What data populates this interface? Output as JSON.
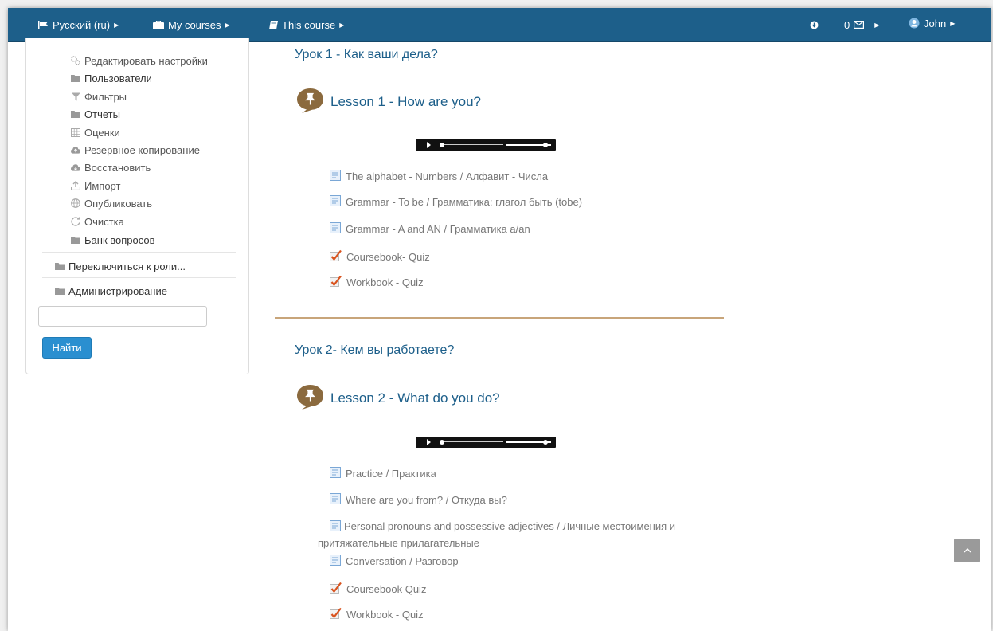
{
  "navbar": {
    "language": "Русский (ru)",
    "my_courses": "My courses",
    "this_course": "This course",
    "messages_count": "0",
    "user": "John"
  },
  "sidebar": {
    "items": [
      {
        "label": "Редактировать настройки",
        "icon": "gears-icon"
      },
      {
        "label": "Пользователи",
        "icon": "folder-icon"
      },
      {
        "label": "Фильтры",
        "icon": "filter-icon"
      },
      {
        "label": "Отчеты",
        "icon": "folder-icon"
      },
      {
        "label": "Оценки",
        "icon": "table-icon"
      },
      {
        "label": "Резервное копирование",
        "icon": "cloud-upload-icon"
      },
      {
        "label": "Восстановить",
        "icon": "cloud-download-icon"
      },
      {
        "label": "Импорт",
        "icon": "upload-icon"
      },
      {
        "label": "Опубликовать",
        "icon": "globe-icon"
      },
      {
        "label": "Очистка",
        "icon": "refresh-icon"
      },
      {
        "label": "Банк вопросов",
        "icon": "folder-icon"
      }
    ],
    "switch_role": "Переключиться к роли...",
    "administration": "Администрирование",
    "search_value": "",
    "search_button": "Найти"
  },
  "sections": [
    {
      "title": "Урок 1 - Как ваши дела?",
      "lesson": "Lesson 1 - How are you?",
      "activities": [
        {
          "label": "The alphabet - Numbers / Алфавит - Числа",
          "type": "page"
        },
        {
          "label": "Grammar - To be / Грамматика: глагол быть (tobe)",
          "type": "page"
        },
        {
          "label": "Grammar - A and AN / Грамматика a/an",
          "type": "page"
        },
        {
          "label": "Coursebook- Quiz",
          "type": "quiz"
        },
        {
          "label": "Workbook - Quiz",
          "type": "quiz"
        }
      ]
    },
    {
      "title": "Урок 2- Кем вы работаете?",
      "lesson": "Lesson 2 - What do you do?",
      "activities": [
        {
          "label": "Practice / Практика",
          "type": "page"
        },
        {
          "label": "Where are you from? / Откуда вы?",
          "type": "page"
        },
        {
          "label": "Personal pronouns and possessive adjectives / Личные местоимения и притяжательные прилагательные",
          "type": "page"
        },
        {
          "label": "Conversation / Разговор",
          "type": "page"
        },
        {
          "label": "Coursebook Quiz",
          "type": "quiz"
        },
        {
          "label": "Workbook - Quiz",
          "type": "quiz"
        }
      ]
    }
  ],
  "colors": {
    "navbar": "#1d5f8a",
    "link": "#1d5f8a",
    "button": "#2a8fd0",
    "divider": "#c8a57a",
    "lesson_icon": "#8b6a3e"
  }
}
